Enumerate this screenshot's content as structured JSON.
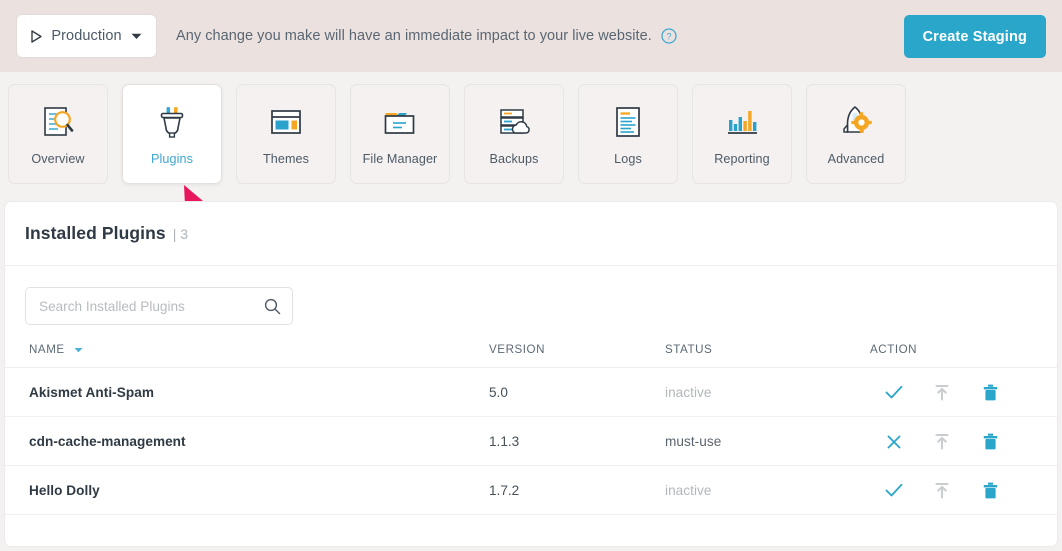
{
  "banner": {
    "env_label": "Production",
    "play_icon": "play-triangle-icon",
    "caret_icon": "chevron-down-icon",
    "note": "Any change you make will have an immediate impact to your live website.",
    "help_icon": "question-circle-icon",
    "create_staging_label": "Create Staging",
    "bg_color": "#EBE2E0",
    "button_color": "#2BA6CB"
  },
  "tabs": [
    {
      "label": "Overview",
      "icon": "document-magnifier-icon",
      "active": false
    },
    {
      "label": "Plugins",
      "icon": "plug-icon",
      "active": true
    },
    {
      "label": "Themes",
      "icon": "layout-window-icon",
      "active": false
    },
    {
      "label": "File Manager",
      "icon": "folder-icon",
      "active": false
    },
    {
      "label": "Backups",
      "icon": "server-cloud-icon",
      "active": false
    },
    {
      "label": "Logs",
      "icon": "document-lines-icon",
      "active": false
    },
    {
      "label": "Reporting",
      "icon": "bar-chart-icon",
      "active": false
    },
    {
      "label": "Advanced",
      "icon": "rocket-gear-icon",
      "active": false
    }
  ],
  "pointer": {
    "icon": "mouse-pointer-arrow",
    "color": "#E8175D"
  },
  "panel": {
    "title": "Installed Plugins",
    "count": "| 3",
    "search": {
      "placeholder": "Search Installed Plugins",
      "value": "",
      "icon": "search-icon"
    },
    "table": {
      "columns": [
        {
          "key": "name",
          "label": "NAME",
          "sorted": true,
          "sort_icon": "sort-caret-down-icon"
        },
        {
          "key": "version",
          "label": "VERSION",
          "sorted": false
        },
        {
          "key": "status",
          "label": "STATUS",
          "sorted": false
        },
        {
          "key": "action",
          "label": "ACTION",
          "sorted": false
        }
      ],
      "rows": [
        {
          "name": "Akismet Anti-Spam",
          "version": "5.0",
          "status": "inactive",
          "status_kind": "inactive",
          "toggle_icon": "check-icon",
          "toggle_enabled": true,
          "update_icon": "update-upload-icon",
          "update_enabled": false,
          "delete_icon": "trash-icon"
        },
        {
          "name": "cdn-cache-management",
          "version": "1.1.3",
          "status": "must-use",
          "status_kind": "muse",
          "toggle_icon": "close-x-icon",
          "toggle_enabled": true,
          "update_icon": "update-upload-icon",
          "update_enabled": false,
          "delete_icon": "trash-icon"
        },
        {
          "name": "Hello Dolly",
          "version": "1.7.2",
          "status": "inactive",
          "status_kind": "inactive",
          "toggle_icon": "check-icon",
          "toggle_enabled": true,
          "update_icon": "update-upload-icon",
          "update_enabled": false,
          "delete_icon": "trash-icon"
        }
      ]
    }
  },
  "colors": {
    "accent": "#2BA6CB",
    "page_bg": "#F4F2F1",
    "text": "#2F3A44",
    "muted": "#B2B7BB",
    "pointer_pink": "#E8175D"
  }
}
